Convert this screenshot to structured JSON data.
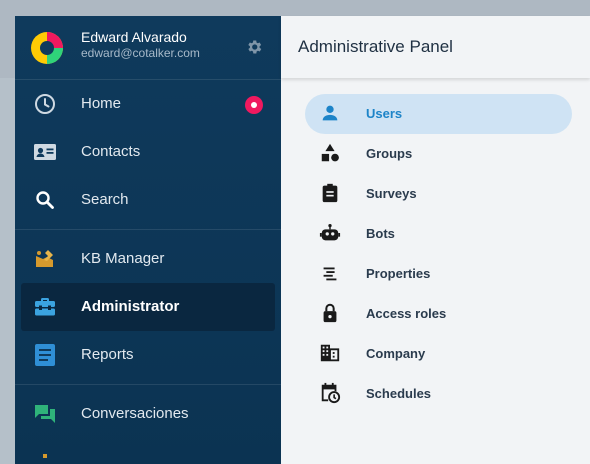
{
  "user": {
    "name": "Edward Alvarado",
    "email": "edward@cotalker.com"
  },
  "sidebar": {
    "items": [
      {
        "label": "Home",
        "icon": "clock-icon"
      },
      {
        "label": "Contacts",
        "icon": "contact-card-icon"
      },
      {
        "label": "Search",
        "icon": "search-icon"
      },
      {
        "label": "KB Manager",
        "icon": "kb-manager-icon"
      },
      {
        "label": "Administrator",
        "icon": "toolbox-icon"
      },
      {
        "label": "Reports",
        "icon": "report-icon"
      },
      {
        "label": "Conversaciones",
        "icon": "chat-icon"
      }
    ],
    "active": "Administrator"
  },
  "main": {
    "title": "Administrative Panel",
    "menu": [
      {
        "label": "Users",
        "icon": "user-icon"
      },
      {
        "label": "Groups",
        "icon": "shapes-icon"
      },
      {
        "label": "Surveys",
        "icon": "clipboard-icon"
      },
      {
        "label": "Bots",
        "icon": "robot-icon"
      },
      {
        "label": "Properties",
        "icon": "lines-icon"
      },
      {
        "label": "Access roles",
        "icon": "lock-icon"
      },
      {
        "label": "Company",
        "icon": "building-icon"
      },
      {
        "label": "Schedules",
        "icon": "calendar-clock-icon"
      }
    ],
    "active": "Users"
  },
  "colors": {
    "sidebar_bg": "#0f3a5c",
    "accent": "#1d84c8",
    "badge": "#f0195f",
    "kb_icon": "#d69a2d",
    "toolbox_icon": "#3ba3e0",
    "reports_icon": "#2f8fd6",
    "chat_icon": "#2fb37a"
  }
}
